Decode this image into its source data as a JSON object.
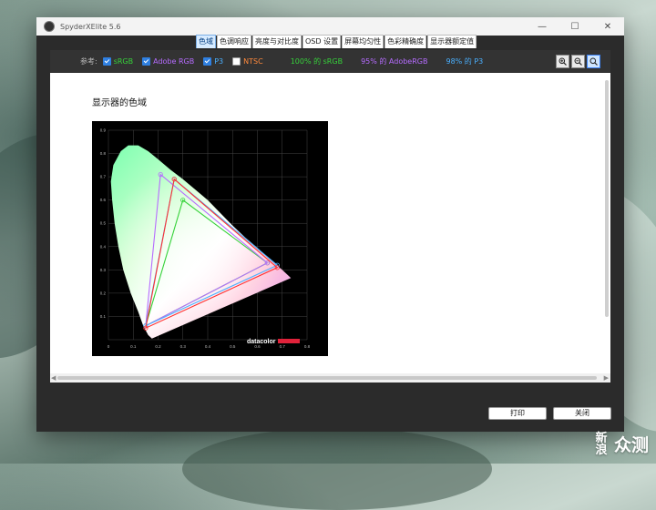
{
  "window": {
    "title": "SpyderXElite 5.6",
    "controls": [
      "—",
      "☐",
      "✕"
    ]
  },
  "tabs": [
    {
      "label": "色域",
      "active": true
    },
    {
      "label": "色调响应",
      "active": false
    },
    {
      "label": "亮度与对比度",
      "active": false
    },
    {
      "label": "OSD 设置",
      "active": false
    },
    {
      "label": "屏幕均匀性",
      "active": false
    },
    {
      "label": "色彩精确度",
      "active": false
    },
    {
      "label": "显示器额定值",
      "active": false
    }
  ],
  "legend": {
    "title": "参考:",
    "items": [
      {
        "label": "sRGB",
        "checked": true,
        "color": "#36d23a"
      },
      {
        "label": "Adobe RGB",
        "checked": true,
        "color": "#b66cff"
      },
      {
        "label": "P3",
        "checked": true,
        "color": "#4ab0ff"
      },
      {
        "label": "NTSC",
        "checked": false,
        "color": "#ff8a3d"
      }
    ],
    "coverage": [
      {
        "text": "100% 的 sRGB",
        "color": "#36d23a"
      },
      {
        "text": "95% 的 AdobeRGB",
        "color": "#b66cff"
      },
      {
        "text": "98% 的 P3",
        "color": "#4ab0ff"
      }
    ]
  },
  "zoom": {
    "zoom_in_icon": "zoom-in-icon",
    "zoom_out_icon": "zoom-out-icon",
    "zoom_fit_icon": "zoom-fit-icon"
  },
  "content": {
    "section_title": "显示器的色域",
    "chart_logo": "datacolor"
  },
  "chart_data": {
    "type": "scatter",
    "xlabel": "",
    "ylabel": "",
    "xlim": [
      0,
      0.8
    ],
    "ylim": [
      0,
      0.9
    ],
    "x_ticks": [
      "0",
      "0.1",
      "0.2",
      "0.3",
      "0.4",
      "0.5",
      "0.6",
      "0.7",
      "0.8"
    ],
    "y_ticks": [
      "0.1",
      "0.2",
      "0.3",
      "0.4",
      "0.5",
      "0.6",
      "0.7",
      "0.8",
      "0.9"
    ],
    "grid": true,
    "series": [
      {
        "name": "sRGB",
        "color": "#36d23a",
        "points": [
          [
            0.64,
            0.33
          ],
          [
            0.3,
            0.6
          ],
          [
            0.15,
            0.06
          ]
        ]
      },
      {
        "name": "Adobe RGB",
        "color": "#b66cff",
        "points": [
          [
            0.64,
            0.33
          ],
          [
            0.21,
            0.71
          ],
          [
            0.15,
            0.06
          ]
        ]
      },
      {
        "name": "P3",
        "color": "#4ab0ff",
        "points": [
          [
            0.68,
            0.32
          ],
          [
            0.265,
            0.69
          ],
          [
            0.15,
            0.06
          ]
        ]
      },
      {
        "name": "",
        "color": "#ff3030",
        "points": [
          [
            0.68,
            0.31
          ],
          [
            0.265,
            0.69
          ],
          [
            0.15,
            0.05
          ]
        ]
      }
    ]
  },
  "footer": {
    "print_label": "打印",
    "close_label": "关闭"
  },
  "watermark": {
    "left": "新浪",
    "right": "众测"
  }
}
